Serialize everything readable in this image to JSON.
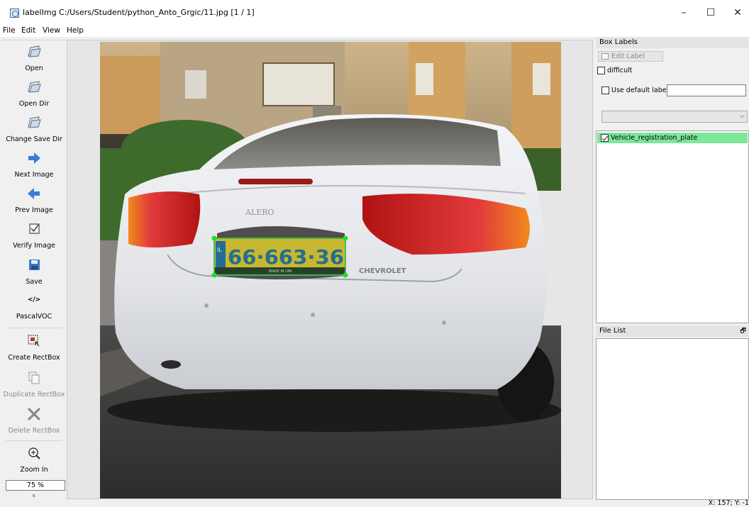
{
  "window": {
    "title": "labelImg C:/Users/Student/python_Anto_Grgic/11.jpg [1 / 1]",
    "minimize": "–",
    "maximize": "☐",
    "close": "✕"
  },
  "menu": {
    "file": "File",
    "edit": "Edit",
    "view": "View",
    "help": "Help"
  },
  "toolbar": {
    "open": "Open",
    "open_dir": "Open Dir",
    "change_save_dir": "Change Save Dir",
    "next_image": "Next Image",
    "prev_image": "Prev Image",
    "verify_image": "Verify Image",
    "save": "Save",
    "format_icon": "</>",
    "format": "PascalVOC",
    "create_rectbox": "Create RectBox",
    "duplicate_rectbox": "Duplicate RectBox",
    "delete_rectbox": "Delete RectBox",
    "zoom_in": "Zoom In",
    "zoom_value": "75 %",
    "more": "»"
  },
  "box_labels": {
    "title": "Box Labels",
    "edit_label": "Edit Label",
    "difficult": "difficult",
    "use_default_label": "Use default label",
    "default_label_value": "",
    "items": [
      {
        "label": "Vehicle_registration_plate",
        "checked": true
      }
    ]
  },
  "file_list": {
    "title": "File List",
    "float_icon": "🗗"
  },
  "plate": {
    "number": "66·663·36",
    "country": "IL",
    "made_in": "MADE IN UMI",
    "brand": "CHEVROLET",
    "model": "ALERO"
  },
  "status": {
    "coords": "X: 157; Y: -1"
  },
  "colors": {
    "selected_label_bg": "#7ee79a",
    "bbox_vertex": "#22dd22",
    "bbox_edge": "#3ccf50"
  }
}
